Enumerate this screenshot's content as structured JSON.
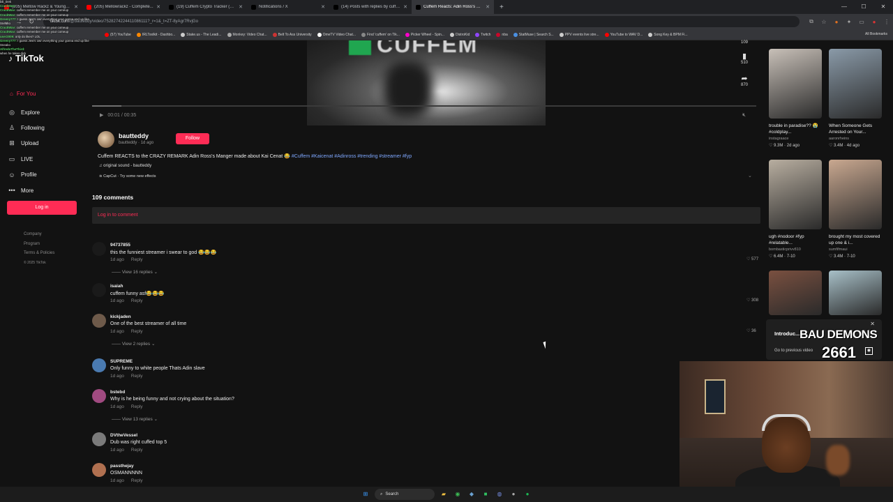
{
  "browser": {
    "tabs": [
      {
        "label": "(205) Meltow Rackz & Youngbo...",
        "color": "#ff0000"
      },
      {
        "label": "(205) Mellowrackz - Complete...",
        "color": "#ff0000"
      },
      {
        "label": "(19) Cuffem Crypto Tracker (@...",
        "color": "#000000"
      },
      {
        "label": "Notifications / X",
        "color": "#000000"
      },
      {
        "label": "(14) Posts with replies by cuffe...",
        "color": "#000000"
      },
      {
        "label": "Cuffem Reacts: Adin Ross's Sh...",
        "color": "#000000"
      }
    ],
    "active_tab": 5,
    "url_host": "tiktok.com",
    "url_path": "/@bauteddy/video/7528274224411086111?_r=1&_t=ZT-8yAgr7RvjGo",
    "bookmarks": [
      "(57) YouTube",
      "IRLToolkit - Dashbo...",
      "Stake.us - The Leadi...",
      "Monkey: Video Chat...",
      "Belt To Ass University",
      "OmeTV Video Chat...",
      "Find 'cuffem' on Tik...",
      "Picker Wheel - Spin...",
      "DistroKid",
      "Twitch",
      "nba",
      "StatMuse | Search S...",
      "PPV events live stre...",
      "YouTube to WAV D...",
      "Song Key & BPM Fi..."
    ],
    "bookmarks_all": "All Bookmarks"
  },
  "sidebar": {
    "logo": "TikTok",
    "for_you": "For You",
    "items": [
      {
        "label": "Explore",
        "icon": "compass-icon"
      },
      {
        "label": "Following",
        "icon": "person-icon"
      },
      {
        "label": "Upload",
        "icon": "plus-square-icon"
      },
      {
        "label": "LIVE",
        "icon": "live-tv-icon"
      },
      {
        "label": "Profile",
        "icon": "profile-icon"
      },
      {
        "label": "More",
        "icon": "dots-icon"
      }
    ],
    "login": "Log in",
    "footer": [
      "Company",
      "Program",
      "Terms & Policies"
    ],
    "copyright": "© 2025 TikTok"
  },
  "chat_overlay": [
    {
      "user": "",
      "text": "bili_tirek"
    },
    {
      "user": "CrackMe4:",
      "text": ""
    },
    {
      "user": "CrackWav:",
      "text": "cuffem remember me on your comeup"
    },
    {
      "user": "CrackWav:",
      "text": "cuffem remember me on your comeup"
    },
    {
      "user": "Greeny777:",
      "text": "I guess Jew's own everything your gonna end up like Sneako"
    },
    {
      "user": "CrackWav:",
      "text": "cuffem remember me on your comeup"
    },
    {
      "user": "CrackWav:",
      "text": "cuffem remember me on your comeup"
    },
    {
      "user": "user2009:",
      "text": "only do likes? LOL"
    },
    {
      "user": "Greeny777:",
      "text": "I guess Jew's own everything your gonna end up like Sneako"
    },
    {
      "user": "AlfredoTheThird:",
      "text": ""
    },
    {
      "user": "",
      "text": "when he takes dick"
    }
  ],
  "video": {
    "brand_text": "CUFFEM",
    "time": "00:01 / 00:35",
    "likes": "109",
    "saves": "510",
    "shares": "870"
  },
  "post": {
    "username": "bautteddy",
    "subline": "bautteddy · 1d ago",
    "follow": "Follow",
    "description": "Cuffem REACTS to the CRAZY REMARK Adin Ross's Manger made about Kai Cenat 😂",
    "hashtags": "#Cuffem #Kaicenat #Adinross #trending #streamer #fyp",
    "sound": "♫ original sound - bautteddy",
    "capcut": "CapCut · Try some new effects"
  },
  "comments_section": {
    "count_label": "109 comments",
    "login_prompt": "Log in to comment",
    "comments": [
      {
        "user": "94737855",
        "text": "this the funniest streamer i swear to god 😂😂😂",
        "time": "1d ago",
        "reply": "Reply",
        "likes": "577",
        "replies": "View 16 replies",
        "avatar": "#1a1a1a"
      },
      {
        "user": "isaiah",
        "text": "cuffem funny asf😂😂😂",
        "time": "1d ago",
        "reply": "Reply",
        "likes": "308",
        "replies": "",
        "avatar": "#1a1a1a"
      },
      {
        "user": "kickjaden",
        "text": "One of the best streamer of all time",
        "time": "1d ago",
        "reply": "Reply",
        "likes": "36",
        "replies": "View 2 replies",
        "avatar": "#6e5a4a"
      },
      {
        "user": "SUPREME",
        "text": "Only funny to white people Thats Adin slave",
        "time": "1d ago",
        "reply": "Reply",
        "likes": "",
        "replies": "",
        "avatar": "#4a7ab0"
      },
      {
        "user": "bstebd",
        "text": "Why is he being funny and not crying about the situation?",
        "time": "1d ago",
        "reply": "Reply",
        "likes": "",
        "replies": "View 13 replies",
        "avatar": "#a04a80"
      },
      {
        "user": "DVtheVessel",
        "text": "Dub was right cuffed top 5",
        "time": "1d ago",
        "reply": "Reply",
        "likes": "",
        "replies": "",
        "avatar": "#7a7a7a"
      },
      {
        "user": "passthejay",
        "text": "OSMANNNNN",
        "time": "1d ago",
        "reply": "Reply",
        "likes": "",
        "replies": "",
        "avatar": "#b07050"
      }
    ]
  },
  "related": [
    {
      "caption": "trouble in paradise?? 😭 #coldplay...",
      "author": "instagraace",
      "views": "9.3M",
      "age": "2d ago",
      "color": "#c8c0b8"
    },
    {
      "caption": "When Someone Gets Arrested on Your...",
      "author": "aaronrheins",
      "views": "3.4M",
      "age": "4d ago",
      "color": "#8a9aa8"
    },
    {
      "caption": "ugh #nodoor #fyp #relatable...",
      "author": "bombasticprivv810",
      "views": "6.4M",
      "age": "7-10",
      "color": "#b8aea0"
    },
    {
      "caption": "brought my most covered up one & i...",
      "author": "sumfifmaui",
      "views": "3.4M",
      "age": "7-10",
      "color": "#c9a890"
    },
    {
      "caption": "",
      "author": "",
      "views": "",
      "age": "",
      "color": "#7a5040"
    },
    {
      "caption": "",
      "author": "",
      "views": "",
      "age": "",
      "color": "#a8c0c8"
    }
  ],
  "popup": {
    "title": "Introduc...",
    "link": "Go to previous video"
  },
  "stream_overlay": {
    "title": "BAU DEMONS",
    "count": "2661"
  },
  "taskbar": {
    "search": "Search"
  }
}
